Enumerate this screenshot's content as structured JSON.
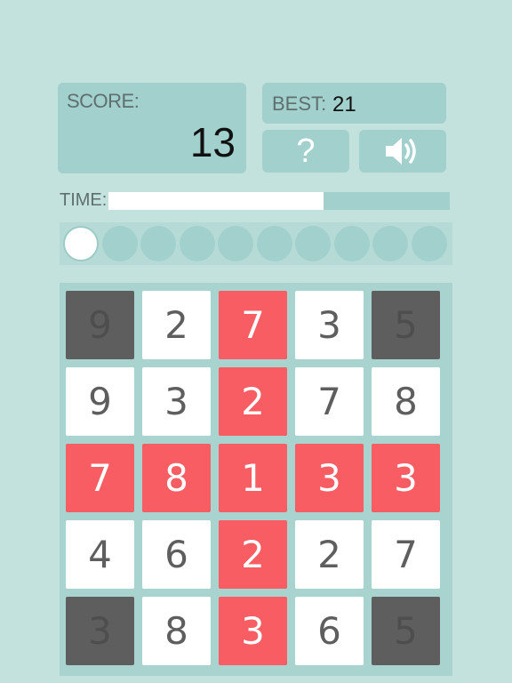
{
  "score": {
    "label": "SCORE:",
    "value": "13"
  },
  "best": {
    "label": "BEST:",
    "value": "21"
  },
  "help_button": {
    "label": "?",
    "icon": "question-mark"
  },
  "sound_button": {
    "icon": "speaker-icon"
  },
  "timer": {
    "label": "TIME:",
    "remaining_fraction": 0.63
  },
  "progress_dots": {
    "total": 10,
    "active_index": 0
  },
  "colors": {
    "background": "#c3e2dd",
    "panel": "#a1d0cd",
    "red_tile": "#f75d63",
    "dark_tile": "#5e5e5e",
    "white_tile": "#ffffff"
  },
  "board": {
    "rows": [
      [
        {
          "n": "9",
          "c": "d"
        },
        {
          "n": "2",
          "c": "w"
        },
        {
          "n": "7",
          "c": "r"
        },
        {
          "n": "3",
          "c": "w"
        },
        {
          "n": "5",
          "c": "d"
        }
      ],
      [
        {
          "n": "9",
          "c": "w"
        },
        {
          "n": "3",
          "c": "w"
        },
        {
          "n": "2",
          "c": "r"
        },
        {
          "n": "7",
          "c": "w"
        },
        {
          "n": "8",
          "c": "w"
        }
      ],
      [
        {
          "n": "7",
          "c": "r"
        },
        {
          "n": "8",
          "c": "r"
        },
        {
          "n": "1",
          "c": "r"
        },
        {
          "n": "3",
          "c": "r"
        },
        {
          "n": "3",
          "c": "r"
        }
      ],
      [
        {
          "n": "4",
          "c": "w"
        },
        {
          "n": "6",
          "c": "w"
        },
        {
          "n": "2",
          "c": "r"
        },
        {
          "n": "2",
          "c": "w"
        },
        {
          "n": "7",
          "c": "w"
        }
      ],
      [
        {
          "n": "3",
          "c": "d"
        },
        {
          "n": "8",
          "c": "w"
        },
        {
          "n": "3",
          "c": "r"
        },
        {
          "n": "6",
          "c": "w"
        },
        {
          "n": "5",
          "c": "d"
        }
      ]
    ]
  }
}
